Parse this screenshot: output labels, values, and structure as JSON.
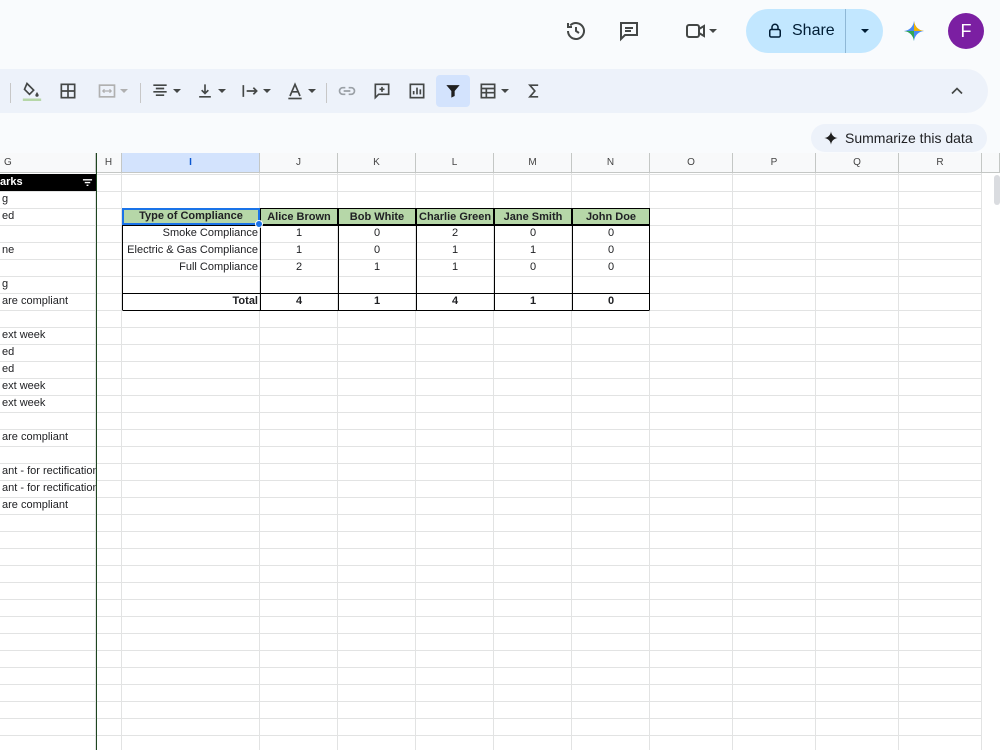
{
  "topbar": {
    "share_label": "Share",
    "avatar_letter": "F",
    "accent": "#c2e7ff",
    "avatar_color": "#7b1fa2"
  },
  "toolbar": {
    "icons": [
      "paint-format-icon",
      "borders-icon",
      "merge-cells-icon",
      "horizontal-align-icon",
      "vertical-align-icon",
      "text-wrap-icon",
      "text-rotation-icon",
      "insert-link-icon",
      "insert-comment-icon",
      "insert-chart-icon",
      "filter-icon",
      "table-view-icon",
      "functions-icon",
      "collapse-icon"
    ]
  },
  "summarize": {
    "label": "Summarize this data"
  },
  "columns": [
    "G",
    "H",
    "I",
    "J",
    "K",
    "L",
    "M",
    "N",
    "O",
    "P",
    "Q",
    "R"
  ],
  "selected_column": "I",
  "column_g": {
    "header": "arks",
    "rows": [
      "g",
      "ed",
      "",
      "ne",
      "",
      "g",
      "are compliant",
      "",
      "ext week",
      "ed",
      "ed",
      "ext week",
      "ext week",
      "",
      "are compliant",
      "",
      "ant - for rectification",
      "ant - for rectification",
      "are compliant"
    ]
  },
  "summary_table": {
    "headers": [
      "Type of Compliance",
      "Alice Brown",
      "Bob White",
      "Charlie Green",
      "Jane Smith",
      "John Doe"
    ],
    "rows": [
      {
        "label": "Smoke Compliance",
        "values": [
          "1",
          "0",
          "2",
          "0",
          "0"
        ]
      },
      {
        "label": "Electric & Gas Compliance",
        "values": [
          "1",
          "0",
          "1",
          "1",
          "0"
        ]
      },
      {
        "label": "Full Compliance",
        "values": [
          "2",
          "1",
          "1",
          "0",
          "0"
        ]
      }
    ],
    "total": {
      "label": "Total",
      "values": [
        "4",
        "1",
        "4",
        "1",
        "0"
      ]
    },
    "header_color": "#b6d7a8"
  }
}
